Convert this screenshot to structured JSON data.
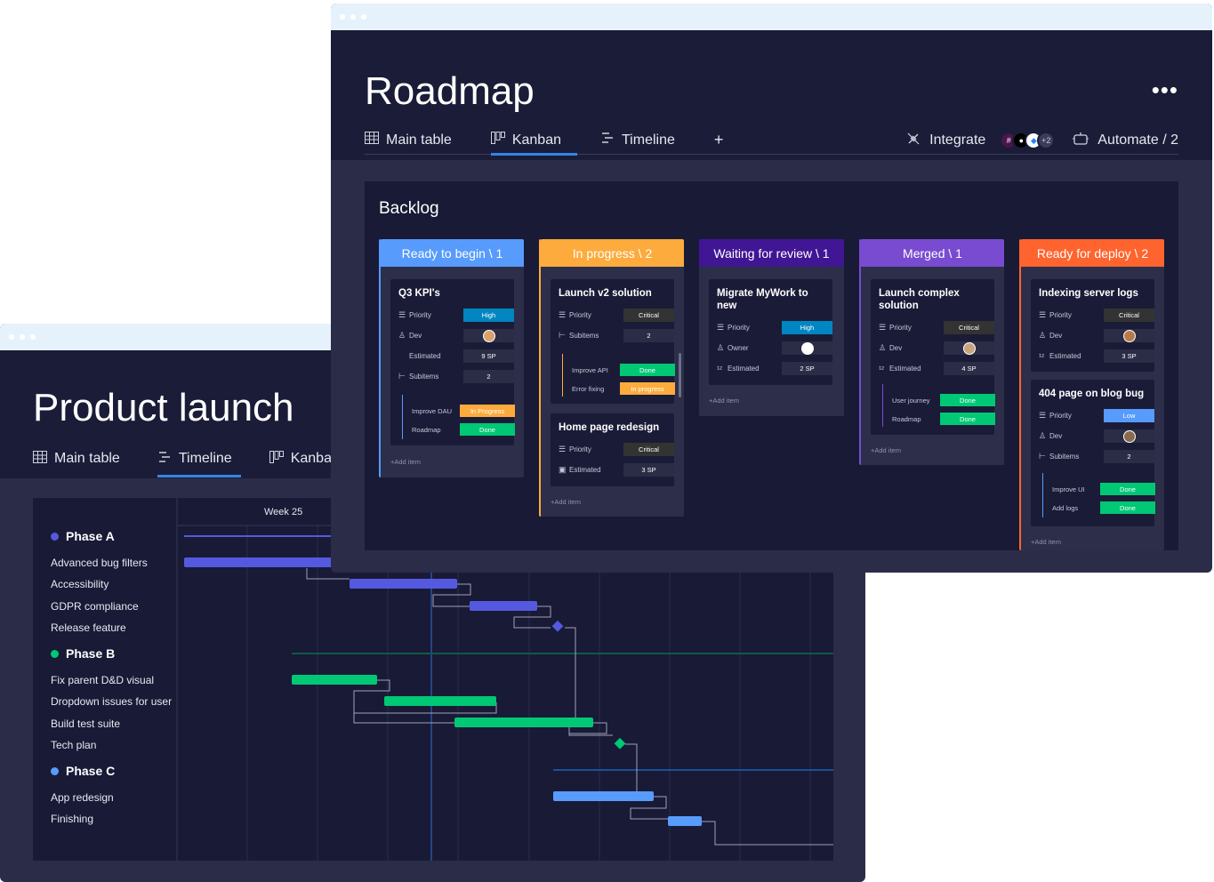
{
  "product_launch": {
    "title": "Product launch",
    "views": [
      {
        "label": "Main table",
        "icon": "table-icon"
      },
      {
        "label": "Timeline",
        "icon": "timeline-icon",
        "active": true
      },
      {
        "label": "Kanban",
        "icon": "kanban-icon"
      }
    ],
    "week_label": "Week 25",
    "phases": [
      {
        "name": "Phase A",
        "color": "#5559df",
        "items": [
          "Advanced bug filters",
          "Accessibility",
          "GDPR compliance",
          "Release feature"
        ]
      },
      {
        "name": "Phase B",
        "color": "#00c875",
        "items": [
          "Fix parent D&D visual",
          "Dropdown issues for user",
          "Build test suite",
          "Tech plan"
        ]
      },
      {
        "name": "Phase C",
        "color": "#579bfc",
        "items": [
          "App redesign",
          "Finishing"
        ]
      }
    ]
  },
  "roadmap": {
    "title": "Roadmap",
    "more_label": "•••",
    "tabs": [
      {
        "label": "Main table",
        "icon": "table-icon"
      },
      {
        "label": "Kanban",
        "icon": "kanban-icon",
        "active": true
      },
      {
        "label": "Timeline",
        "icon": "timeline-icon"
      }
    ],
    "add_tab": "+",
    "integrate_label": "Integrate",
    "integrations_more": "+2",
    "automate_label": "Automate / 2",
    "board_title": "Backlog",
    "add_item_label": "+Add item",
    "columns": [
      {
        "title": "Ready to begin \\ 1",
        "color": "#579bfc",
        "cards": [
          {
            "title": "Q3 KPI's",
            "fields": [
              {
                "icon": "priority-icon",
                "label": "Priority",
                "value": "High",
                "color": "#0086c0"
              },
              {
                "icon": "person-icon",
                "label": "Dev",
                "value": "",
                "avatar": true
              },
              {
                "icon": "",
                "label": "Estimated",
                "value": "9 SP"
              },
              {
                "icon": "subitems-icon",
                "label": "Subitems",
                "value": "2"
              }
            ],
            "subitems": [
              {
                "label": "Improve DAU",
                "status": "In Progress",
                "color": "#fdab3d"
              },
              {
                "label": "Roadmap",
                "status": "Done",
                "color": "#00c875"
              }
            ]
          }
        ]
      },
      {
        "title": "In progress \\ 2",
        "color": "#fdab3d",
        "cards": [
          {
            "title": "Launch v2 solution",
            "fields": [
              {
                "icon": "priority-icon",
                "label": "Priority",
                "value": "Critical",
                "color": "#333333"
              },
              {
                "icon": "subitems-icon",
                "label": "Subitems",
                "value": "2"
              }
            ],
            "subitems": [
              {
                "label": "Improve API",
                "status": "Done",
                "color": "#00c875"
              },
              {
                "label": "Error fixing",
                "status": "In progress",
                "color": "#fdab3d"
              }
            ]
          },
          {
            "title": "Home page redesign",
            "fields": [
              {
                "icon": "priority-icon",
                "label": "Priority",
                "value": "Critical",
                "color": "#333333"
              },
              {
                "icon": "calendar-icon",
                "label": "Estimated",
                "value": "3 SP"
              }
            ],
            "subitems": []
          }
        ]
      },
      {
        "title": "Waiting for review \\ 1",
        "color": "#401694",
        "cards": [
          {
            "title": "Migrate MyWork to new",
            "fields": [
              {
                "icon": "priority-icon",
                "label": "Priority",
                "value": "High",
                "color": "#0086c0"
              },
              {
                "icon": "person-icon",
                "label": "Owner",
                "value": "",
                "avatar": true
              },
              {
                "icon": "number-icon",
                "label": "Estimated",
                "value": "2 SP"
              }
            ],
            "subitems": []
          }
        ]
      },
      {
        "title": "Merged \\ 1",
        "color": "#784bd1",
        "cards": [
          {
            "title": "Launch complex solution",
            "fields": [
              {
                "icon": "priority-icon",
                "label": "Priority",
                "value": "Critical",
                "color": "#333333"
              },
              {
                "icon": "person-icon",
                "label": "Dev",
                "value": "",
                "avatar": true
              },
              {
                "icon": "number-icon",
                "label": "Estimated",
                "value": "4 SP"
              }
            ],
            "subitems": [
              {
                "label": "User journey",
                "status": "Done",
                "color": "#00c875"
              },
              {
                "label": "Roadmap",
                "status": "Done",
                "color": "#00c875"
              }
            ]
          }
        ]
      },
      {
        "title": "Ready for deploy \\ 2",
        "color": "#ff642e",
        "cards": [
          {
            "title": "Indexing server logs",
            "fields": [
              {
                "icon": "priority-icon",
                "label": "Priority",
                "value": "Critical",
                "color": "#333333"
              },
              {
                "icon": "person-icon",
                "label": "Dev",
                "value": "",
                "avatar": true
              },
              {
                "icon": "number-icon",
                "label": "Estimated",
                "value": "3 SP"
              }
            ],
            "subitems": []
          },
          {
            "title": "404 page on blog bug",
            "fields": [
              {
                "icon": "priority-icon",
                "label": "Priority",
                "value": "Low",
                "color": "#579bfc"
              },
              {
                "icon": "person-icon",
                "label": "Dev",
                "value": "",
                "avatar": true
              },
              {
                "icon": "subitems-icon",
                "label": "Subitems",
                "value": "2"
              }
            ],
            "subitems": [
              {
                "label": "Improve UI",
                "status": "Done",
                "color": "#00c875"
              },
              {
                "label": "Add logs",
                "status": "Done",
                "color": "#00c875"
              }
            ]
          }
        ]
      }
    ]
  }
}
